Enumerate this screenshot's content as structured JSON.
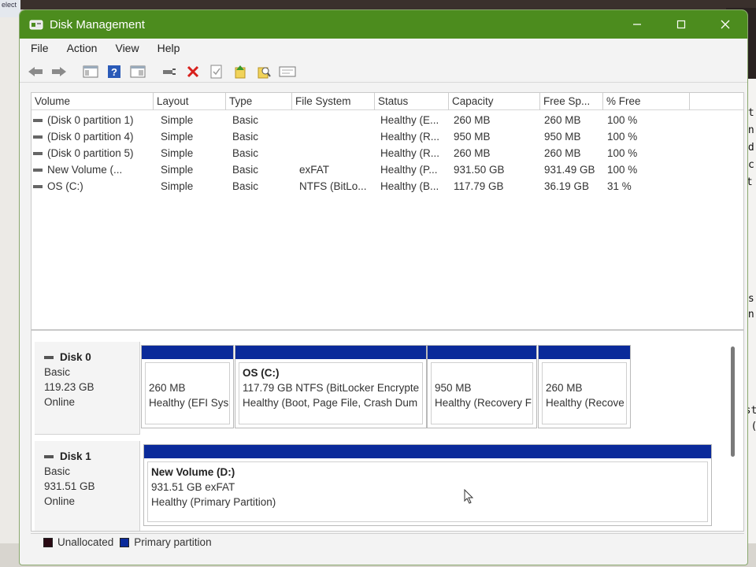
{
  "window": {
    "title": "Disk Management"
  },
  "colors": {
    "titlebar": "#4c8c1e",
    "primary_partition": "#0a2a9a",
    "unallocated": "#2a0a14"
  },
  "menu": [
    "File",
    "Action",
    "View",
    "Help"
  ],
  "toolbar": [
    "back-icon",
    "forward-icon",
    "console-tree-icon",
    "help-icon",
    "properties-icon",
    "connect-icon",
    "delete-icon",
    "check-icon",
    "import-icon",
    "search-icon",
    "view-icon"
  ],
  "columns": [
    "Volume",
    "Layout",
    "Type",
    "File System",
    "Status",
    "Capacity",
    "Free Sp...",
    "% Free"
  ],
  "volumes": [
    {
      "volume": "(Disk 0 partition 1)",
      "layout": "Simple",
      "type": "Basic",
      "fs": "",
      "status": "Healthy (E...",
      "capacity": "260 MB",
      "free": "260 MB",
      "pct": "100 %"
    },
    {
      "volume": "(Disk 0 partition 4)",
      "layout": "Simple",
      "type": "Basic",
      "fs": "",
      "status": "Healthy (R...",
      "capacity": "950 MB",
      "free": "950 MB",
      "pct": "100 %"
    },
    {
      "volume": "(Disk 0 partition 5)",
      "layout": "Simple",
      "type": "Basic",
      "fs": "",
      "status": "Healthy (R...",
      "capacity": "260 MB",
      "free": "260 MB",
      "pct": "100 %"
    },
    {
      "volume": "New Volume (...",
      "layout": "Simple",
      "type": "Basic",
      "fs": "exFAT",
      "status": "Healthy (P...",
      "capacity": "931.50 GB",
      "free": "931.49 GB",
      "pct": "100 %"
    },
    {
      "volume": "OS (C:)",
      "layout": "Simple",
      "type": "Basic",
      "fs": "NTFS (BitLo...",
      "status": "Healthy (B...",
      "capacity": "117.79 GB",
      "free": "36.19 GB",
      "pct": "31 %"
    }
  ],
  "disks": [
    {
      "name": "Disk 0",
      "type": "Basic",
      "size": "119.23 GB",
      "state": "Online",
      "partitions": [
        {
          "name": "",
          "line1": "260 MB",
          "line2": "Healthy (EFI Sys"
        },
        {
          "name": "OS  (C:)",
          "line1": "117.79 GB NTFS (BitLocker Encrypte",
          "line2": "Healthy (Boot, Page File, Crash Dum"
        },
        {
          "name": "",
          "line1": "950 MB",
          "line2": "Healthy (Recovery F"
        },
        {
          "name": "",
          "line1": "260 MB",
          "line2": "Healthy (Recove"
        }
      ]
    },
    {
      "name": "Disk 1",
      "type": "Basic",
      "size": "931.51 GB",
      "state": "Online",
      "partitions": [
        {
          "name": "New Volume  (D:)",
          "line1": "931.51 GB exFAT",
          "line2": "Healthy (Primary Partition)"
        }
      ]
    }
  ],
  "legend": [
    "Unallocated",
    "Primary partition"
  ],
  "background": {
    "left_text": "elect",
    "right_terminal": [
      "ct",
      "in",
      "ld",
      "c",
      "at",
      "is",
      "an",
      "list",
      "n. ("
    ]
  }
}
